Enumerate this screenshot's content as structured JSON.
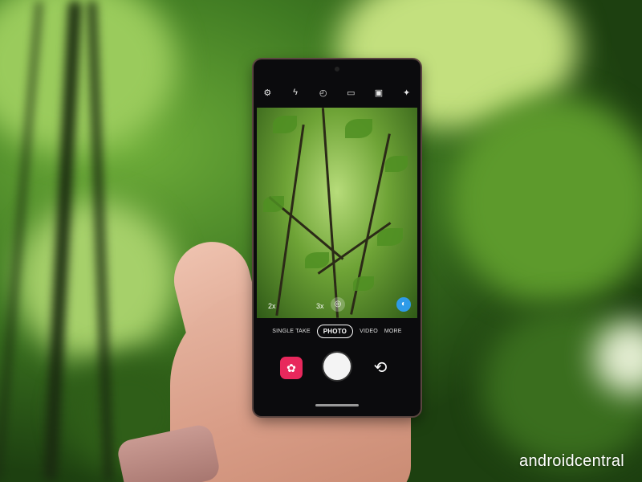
{
  "camera": {
    "top_icons": [
      {
        "name": "settings-icon",
        "glyph": "⚙"
      },
      {
        "name": "flash-off-icon",
        "glyph": "ϟ"
      },
      {
        "name": "timer-off-icon",
        "glyph": "◴"
      },
      {
        "name": "aspect-ratio-icon",
        "glyph": "▭"
      },
      {
        "name": "motion-photo-icon",
        "glyph": "▣"
      },
      {
        "name": "filters-icon",
        "glyph": "✦"
      }
    ],
    "zoom_levels": [
      "2x",
      "3x"
    ],
    "modes": [
      "SINGLE TAKE",
      "PHOTO",
      "VIDEO",
      "MORE"
    ],
    "active_mode": "PHOTO",
    "gallery_glyph": "✿",
    "switch_glyph": "⟲",
    "ai_glyph": "◐",
    "lens_glyph": "◎"
  },
  "watermark": "androidcentral",
  "colors": {
    "gallery": "#e8285c",
    "ai_button": "#2e9be8"
  }
}
